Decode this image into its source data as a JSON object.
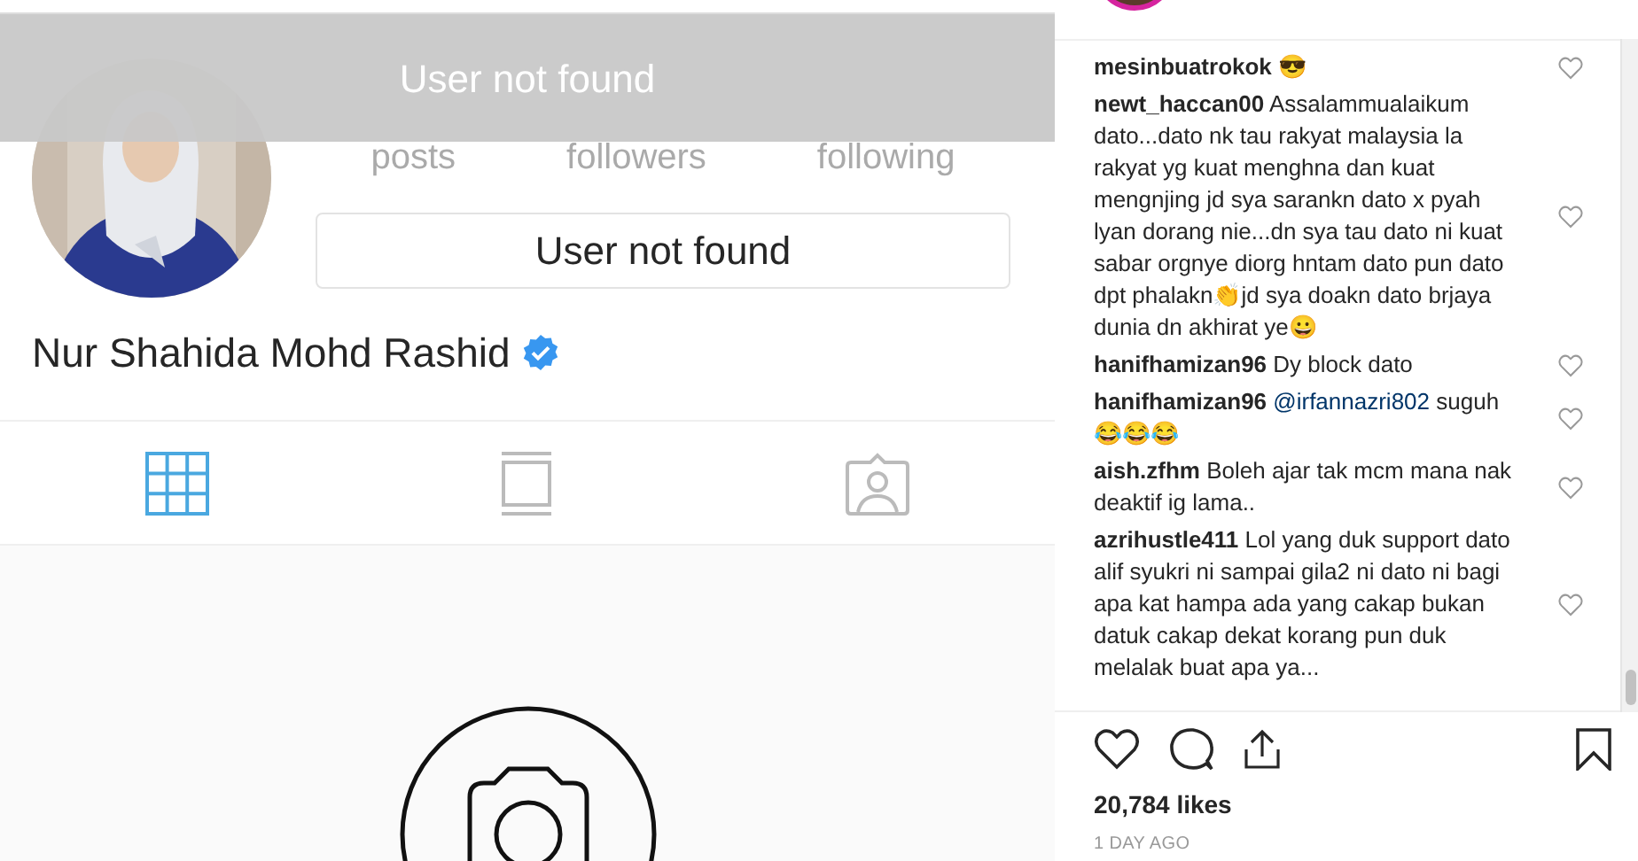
{
  "toast": {
    "text": "User not found"
  },
  "profile": {
    "stat_labels": [
      "posts",
      "followers",
      "following"
    ],
    "button": "User not found",
    "name": "Nur Shahida Mohd Rashid",
    "verified": true
  },
  "tabs": [
    {
      "kind": "grid",
      "selected": true
    },
    {
      "kind": "feed",
      "selected": false
    },
    {
      "kind": "tagged",
      "selected": false
    }
  ],
  "comments": [
    {
      "user": "mesinbuatrokok",
      "text": "😎"
    },
    {
      "user": "newt_haccan00",
      "text": "Assalammualaikum dato...dato nk tau rakyat malaysia la rakyat yg kuat menghna dan kuat mengnjing jd sya sarankn dato x pyah lyan dorang nie...dn sya tau dato ni kuat sabar orgnye diorg hntam dato pun dato dpt phalakn👏jd sya doakn dato brjaya dunia dn akhirat ye😀"
    },
    {
      "user": "hanifhamizan96",
      "text": "Dy block dato"
    },
    {
      "user": "hanifhamizan96",
      "mention": "@irfannazri802",
      "text": "suguh😂😂😂"
    },
    {
      "user": "aish.zfhm",
      "text": "Boleh ajar tak mcm mana nak deaktif ig lama.."
    },
    {
      "user": "azrihustle411",
      "text": "Lol yang duk support dato alif syukri ni sampai gila2 ni dato ni bagi apa kat hampa ada yang cakap bukan datuk cakap dekat korang pun duk melalak buat apa ya..."
    }
  ],
  "likes": "20,784 likes",
  "time": "1 DAY AGO"
}
